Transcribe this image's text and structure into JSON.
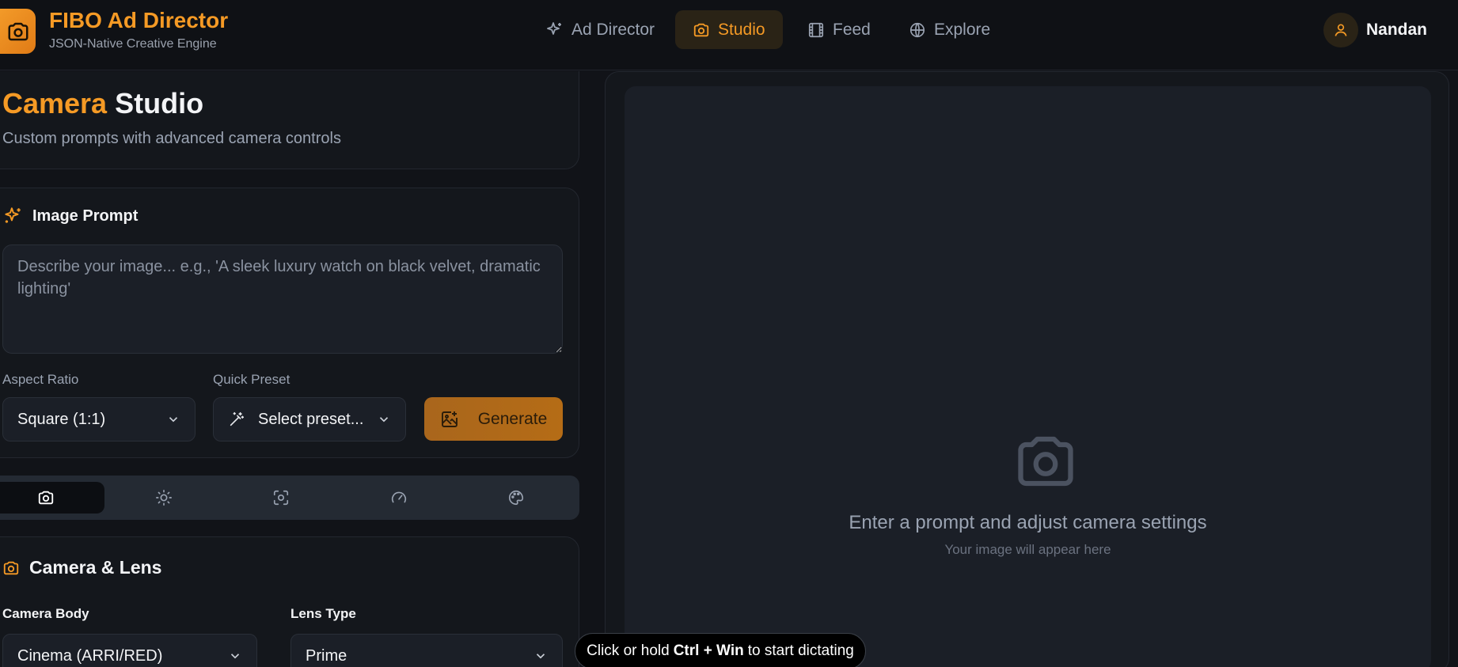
{
  "header": {
    "brand_title": "FIBO Ad Director",
    "brand_subtitle": "JSON-Native Creative Engine",
    "nav": [
      {
        "label": "Ad Director",
        "icon": "sparkles-icon",
        "active": false
      },
      {
        "label": "Studio",
        "icon": "camera-icon",
        "active": true
      },
      {
        "label": "Feed",
        "icon": "film-icon",
        "active": false
      },
      {
        "label": "Explore",
        "icon": "globe-icon",
        "active": false
      }
    ],
    "user_name": "Nandan"
  },
  "studio": {
    "title_accent": "Camera",
    "title_rest": "Studio",
    "subtitle": "Custom prompts with advanced camera controls"
  },
  "prompt": {
    "heading": "Image Prompt",
    "placeholder": "Describe your image... e.g., 'A sleek luxury watch on black velvet, dramatic lighting'",
    "aspect_label": "Aspect Ratio",
    "aspect_value": "Square (1:1)",
    "preset_label": "Quick Preset",
    "preset_value": "Select preset...",
    "generate_label": "Generate"
  },
  "tabs": [
    {
      "icon": "camera-icon",
      "active": true
    },
    {
      "icon": "sun-icon",
      "active": false
    },
    {
      "icon": "focus-icon",
      "active": false
    },
    {
      "icon": "gauge-icon",
      "active": false
    },
    {
      "icon": "palette-icon",
      "active": false
    }
  ],
  "camera_lens": {
    "heading": "Camera & Lens",
    "body_label": "Camera Body",
    "body_value": "Cinema (ARRI/RED)",
    "lens_label": "Lens Type",
    "lens_value": "Prime"
  },
  "preview": {
    "title": "Enter a prompt and adjust camera settings",
    "subtitle": "Your image will appear here"
  },
  "toast": {
    "prefix": "Click or hold",
    "shortcut": "Ctrl + Win",
    "suffix": "to start dictating"
  },
  "colors": {
    "accent": "#f59a25",
    "background": "#111318",
    "card": "#14171c",
    "input": "#1b1f27"
  }
}
